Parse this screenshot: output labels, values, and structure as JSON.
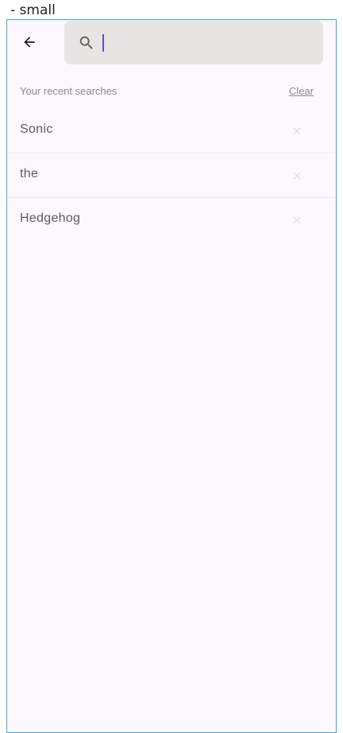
{
  "device_label": "- small",
  "search": {
    "value": "",
    "placeholder": ""
  },
  "recent": {
    "title": "Your recent searches",
    "clear_label": "Clear",
    "items": [
      {
        "label": "Sonic"
      },
      {
        "label": "the"
      },
      {
        "label": "Hedgehog"
      }
    ]
  },
  "icons": {
    "back": "arrow-back-icon",
    "search": "search-icon",
    "remove": "close-icon"
  },
  "colors": {
    "background": "#fdf7fe",
    "search_bar": "#e7e5e3",
    "caret": "#6b4fb3",
    "frame_border": "#3da8db"
  }
}
